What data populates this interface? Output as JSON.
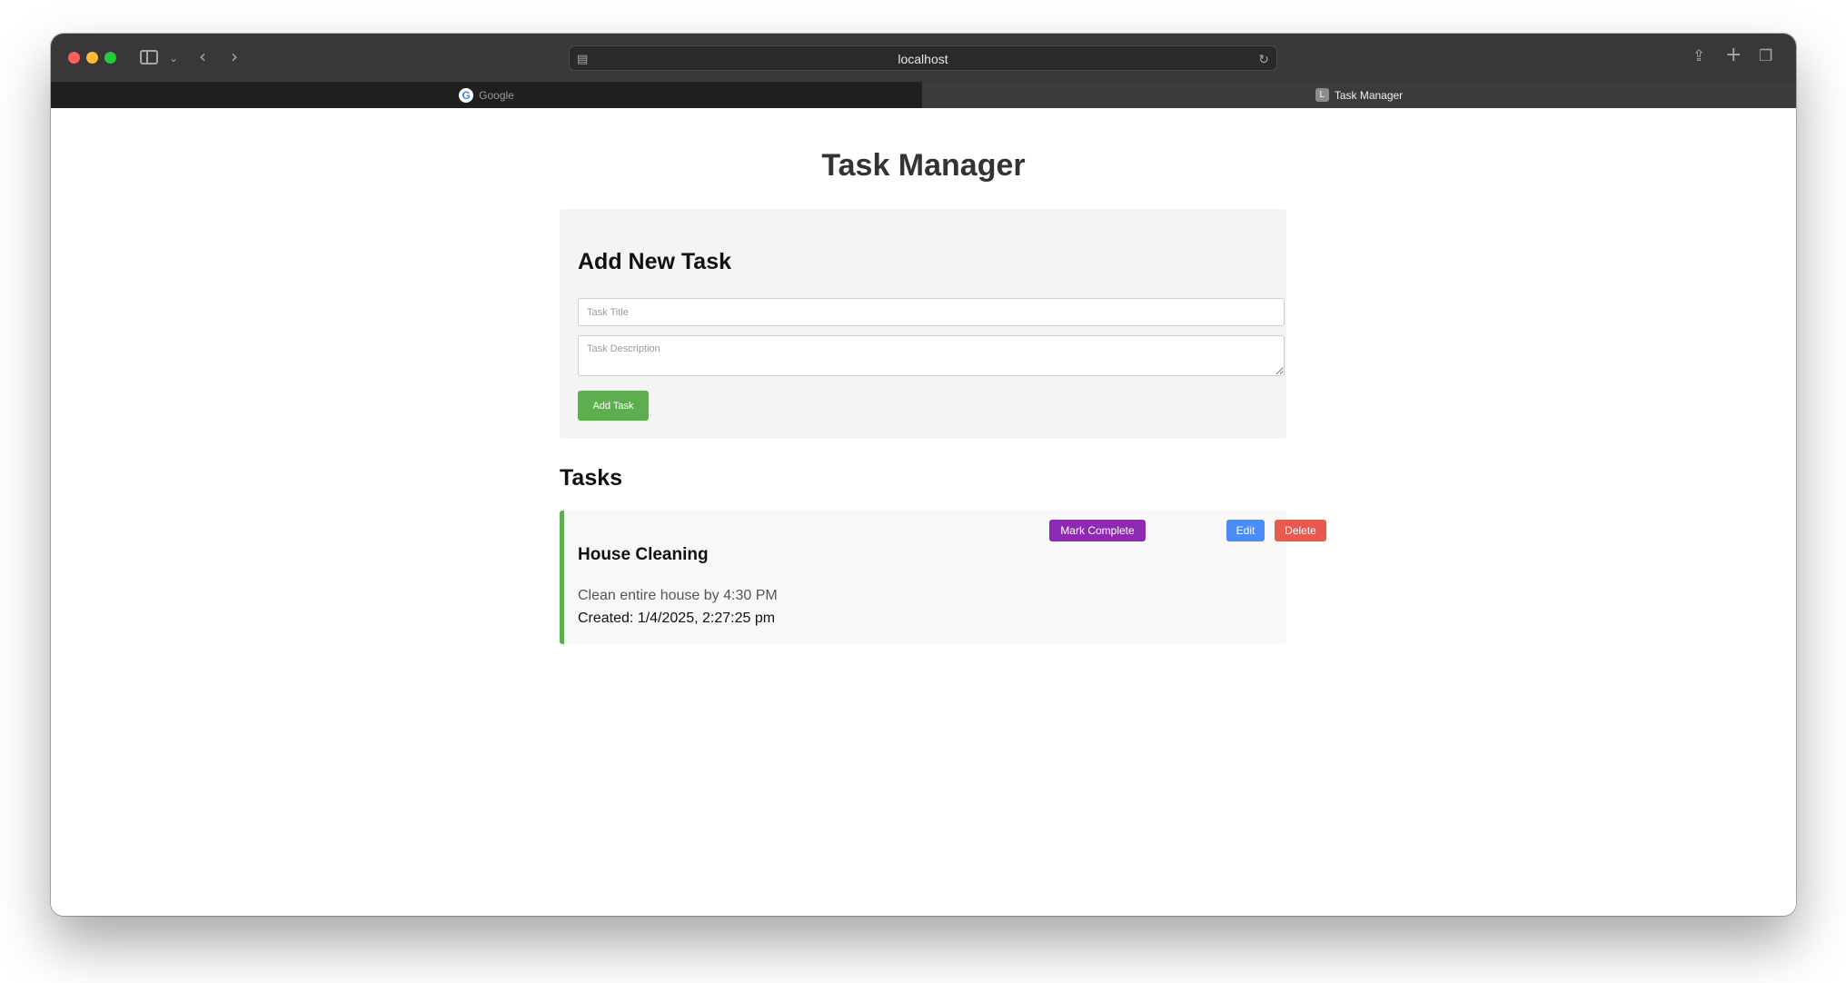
{
  "browser": {
    "url": "localhost",
    "tabs": [
      {
        "label": "Google",
        "favicon": "G"
      },
      {
        "label": "Task Manager",
        "favicon": "L"
      }
    ]
  },
  "page": {
    "title": "Task Manager"
  },
  "form": {
    "heading": "Add New Task",
    "title_placeholder": "Task Title",
    "title_value": "",
    "description_placeholder": "Task Description",
    "description_value": "",
    "add_button_label": "Add Task"
  },
  "tasks": {
    "heading": "Tasks",
    "items": [
      {
        "title": "House Cleaning",
        "description": "Clean entire house by 4:30 PM",
        "created": "Created: 1/4/2025, 2:27:25 pm",
        "complete_label": "Mark Complete",
        "edit_label": "Edit",
        "delete_label": "Delete"
      }
    ]
  },
  "colors": {
    "add_button": "#5cae4f",
    "complete_button": "#8c2ab4",
    "edit_button": "#4b8df5",
    "delete_button": "#e85a50",
    "task_border": "#5cae4f"
  }
}
